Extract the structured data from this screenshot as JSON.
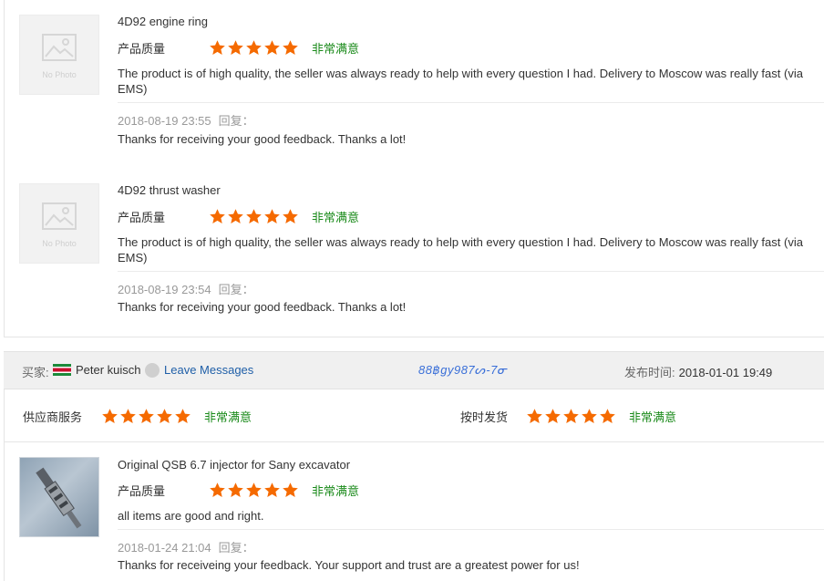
{
  "items": [
    {
      "product": "4D92 engine ring",
      "quality_label": "产品质量",
      "satisfaction": "非常满意",
      "stars": 5,
      "review": "The product is of high quality, the seller was always ready to help with every question I had. Delivery to Moscow was really fast (via EMS)",
      "date": "2018-08-19 23:55",
      "reply_label": "回复：",
      "reply": "Thanks for receiving your good feedback. Thanks a lot!",
      "thumb_text": "No Photo"
    },
    {
      "product": "4D92 thrust washer",
      "quality_label": "产品质量",
      "satisfaction": "非常满意",
      "stars": 5,
      "review": "The product is of high quality, the seller was always ready to help with every question I had. Delivery to Moscow was really fast (via EMS)",
      "date": "2018-08-19 23:54",
      "reply_label": "回复：",
      "reply": "Thanks for receiving your good feedback. Thanks a lot!",
      "thumb_text": "No Photo"
    }
  ],
  "buyer": {
    "label": "买家:",
    "name": "Peter kuisch",
    "leave_messages": "Leave Messages",
    "phone_text": "88฿gy987ᔕ-7ᓂ",
    "published_label": "发布时间:",
    "published_time": "2018-01-01 19:49",
    "flag_colors": [
      "#1b8a3a",
      "#ffffff",
      "#c8102e",
      "#ffffff",
      "#1b8a3a"
    ]
  },
  "service": {
    "supplier_label": "供应商服务",
    "supplier_stars": 5,
    "supplier_satisfaction": "非常满意",
    "ontime_label": "按时发货",
    "ontime_stars": 5,
    "ontime_satisfaction": "非常满意"
  },
  "item3": {
    "product": "Original QSB 6.7 injector for Sany excavator",
    "quality_label": "产品质量",
    "satisfaction": "非常满意",
    "stars": 5,
    "review": "all items are good and right.",
    "date": "2018-01-24 21:04",
    "reply_label": "回复：",
    "reply": "Thanks for receiveing your feedback. Your support and trust are a greatest power for us!"
  },
  "colors": {
    "star": "#f56a00",
    "satisfied": "#1a8a1a",
    "link": "#1f5fa8"
  }
}
